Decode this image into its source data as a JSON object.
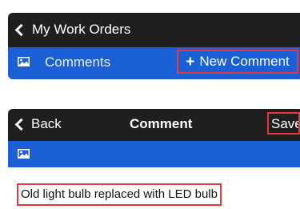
{
  "colors": {
    "header_dark": "#1f1f1f",
    "accent_blue": "#1a5fd6",
    "highlight_red": "#e8383d"
  },
  "list_screen": {
    "back_icon": "chevron-left-icon",
    "title": "My Work Orders",
    "tab_icon": "picture-icon",
    "tab_label": "Comments",
    "new_comment_icon": "plus-icon",
    "new_comment_label": "New Comment"
  },
  "comment_screen": {
    "back_icon": "chevron-left-icon",
    "back_label": "Back",
    "title": "Comment",
    "save_label": "Save",
    "toolbar_icon": "picture-icon",
    "comment_text": "Old light bulb replaced with LED bulb"
  }
}
